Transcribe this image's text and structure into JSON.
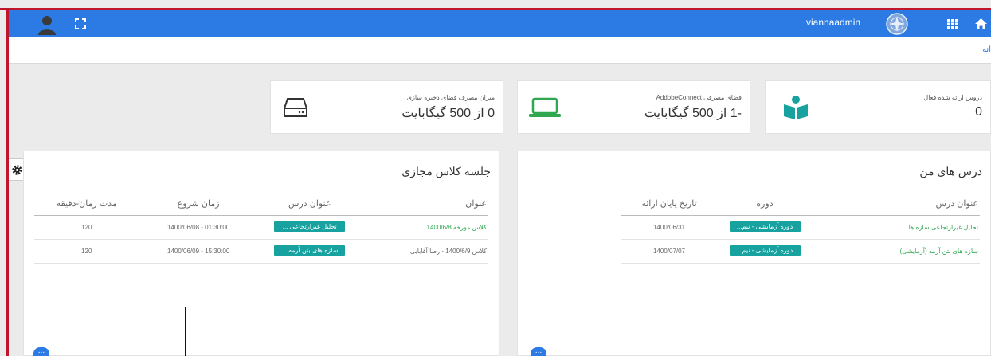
{
  "topbar": {
    "username": "viannaadmin",
    "icons": [
      "avatar-icon",
      "fullscreen-icon",
      "logo",
      "grid-icon",
      "home-icon"
    ],
    "color": "#2c7be5"
  },
  "breadcrumb": {
    "item": "انه"
  },
  "stats": [
    {
      "label": "دروس ارائه شده فعال",
      "value": "0",
      "icon": "book-reader-icon"
    },
    {
      "label": "فضای مصرفی AddobeConnect",
      "value": "-1 از 500 گیگابایت",
      "icon": "laptop-icon"
    },
    {
      "label": "میزان مصرف فضای ذخیره سازی",
      "value": "0 از 500 گیگابایت",
      "icon": "hard-drive-icon"
    }
  ],
  "my_courses": {
    "title": "درس های من",
    "columns": [
      "عنوان درس",
      "دوره",
      "تاریخ پایان ارائه"
    ],
    "rows": [
      {
        "course": "تحلیل غیرارتجاعی سازه ها",
        "term": "دوره آزمایشی - نیم...",
        "end_date": "1400/06/31"
      },
      {
        "course": "سازه های بتن آرمه (آزمایشی)",
        "term": "دوره آزمایشی - نیم...",
        "end_date": "1400/07/07"
      }
    ],
    "more": "..."
  },
  "virtual_class": {
    "title": "جلسه کلاس مجازی",
    "columns": [
      "عنوان",
      "عنوان درس",
      "زمان شروع",
      "مدت زمان-دقیقه"
    ],
    "rows": [
      {
        "title": "کلاس مورخه 1400/6/8...",
        "course": "تحلیل غیرارتجاعی ...",
        "start": "01:30:00 - 1400/06/08",
        "duration": "120"
      },
      {
        "title": "کلاس 1400/6/9 - رضا آقابابی",
        "course": "سازه های بتن آرمه ...",
        "start": "15:30:00 - 1400/06/09",
        "duration": "120"
      }
    ],
    "more": "..."
  },
  "colors": {
    "accent": "#2c7be5",
    "badge": "#17a2a0",
    "link": "#2fa84f",
    "frame": "#c0162b"
  }
}
